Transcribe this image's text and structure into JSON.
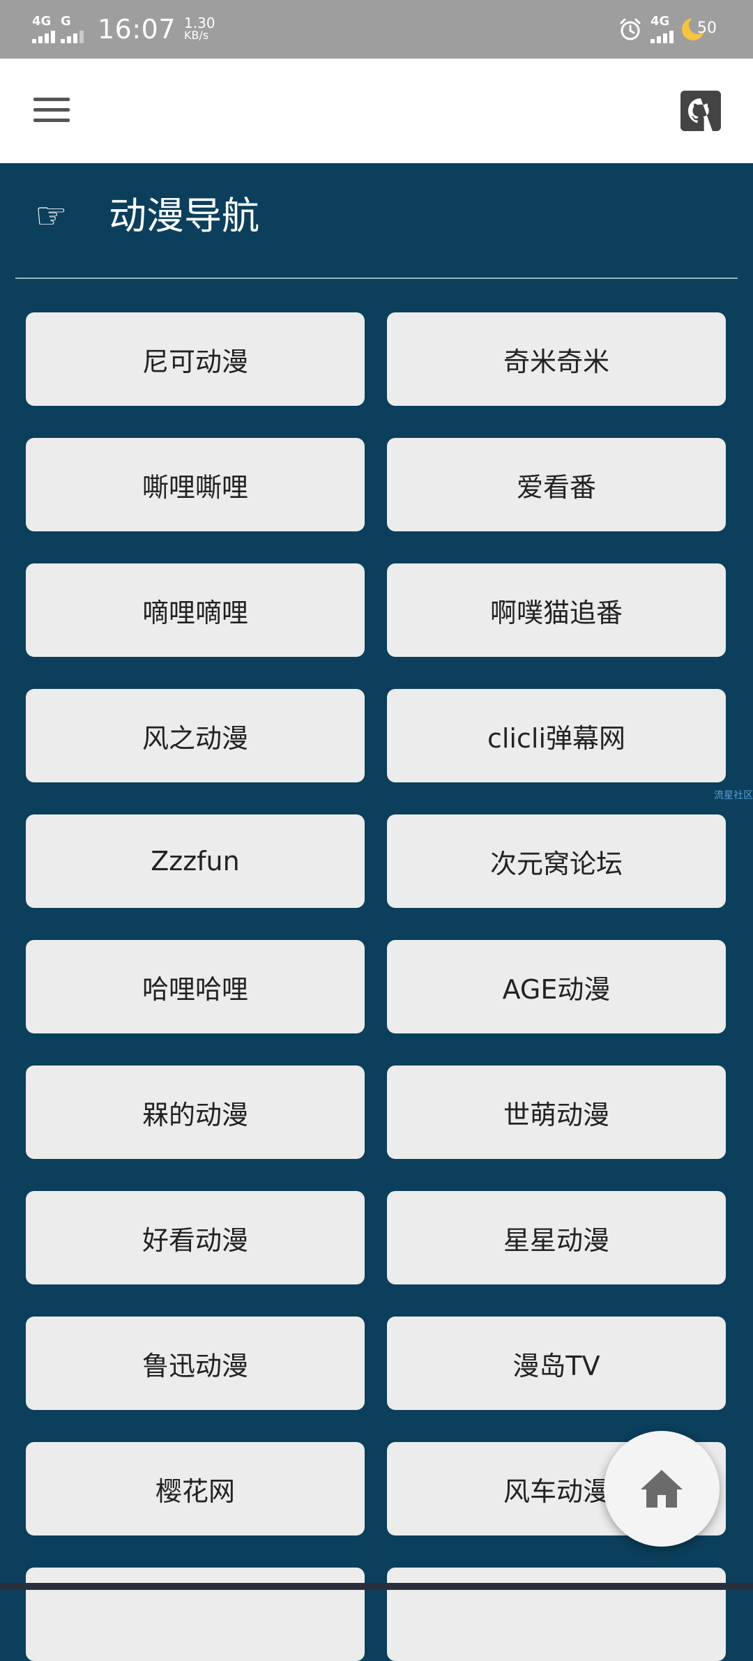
{
  "status_bar": {
    "sim1_label": "4G",
    "sim2_label": "G",
    "time": "16:07",
    "net_speed_value": "1.30",
    "net_speed_unit": "KB/s",
    "right_network": "4G",
    "battery_level": "50",
    "icons": [
      "signal-icon",
      "alarm-icon",
      "moon-icon"
    ]
  },
  "app_bar": {
    "icons": [
      "menu-icon",
      "github-icon"
    ]
  },
  "section": {
    "icon": "pointing-hand-icon",
    "icon_glyph": "☞",
    "title": "动漫导航"
  },
  "nav_items": [
    "尼可动漫",
    "奇米奇米",
    "嘶哩嘶哩",
    "爱看番",
    "嘀哩嘀哩",
    "啊噗猫追番",
    "风之动漫",
    "clicli弹幕网",
    "Zzzfun",
    "次元窝论坛",
    "哈哩哈哩",
    "AGE动漫",
    "槑的动漫",
    "世萌动漫",
    "好看动漫",
    "星星动漫",
    "鲁迅动漫",
    "漫岛TV",
    "樱花网",
    "风车动漫",
    "",
    ""
  ],
  "watermark": "流星社区",
  "fab": {
    "icon": "home-icon"
  },
  "colors": {
    "background": "#0b3f5c",
    "button": "#ececec",
    "status_bar": "#9e9e9e"
  }
}
